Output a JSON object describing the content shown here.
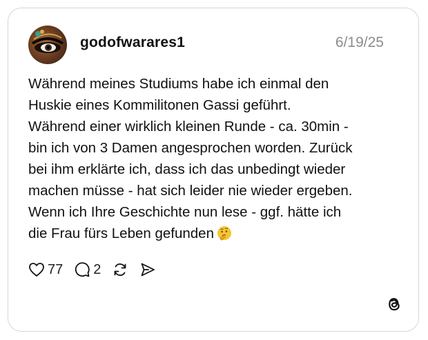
{
  "post": {
    "username": "godofwarares1",
    "date": "6/19/25",
    "lines": [
      "Während meines Studiums habe ich einmal den",
      "Huskie eines Kommilitonen Gassi geführt.",
      "Während einer wirklich kleinen Runde - ca. 30min -",
      "bin ich von 3 Damen angesprochen worden. Zurück",
      "bei ihm erklärte ich, dass ich das unbedingt wieder",
      "machen müsse - hat sich leider nie wieder ergeben.",
      "Wenn ich Ihre Geschichte nun lese - ggf. hätte ich",
      "die Frau fürs Leben gefunden"
    ],
    "emoji": "thinking-face"
  },
  "actions": {
    "likes": "77",
    "replies": "2",
    "icons": [
      "heart-icon",
      "comment-icon",
      "repost-icon",
      "share-icon"
    ]
  },
  "brand": {
    "logo": "threads-logo-icon"
  }
}
